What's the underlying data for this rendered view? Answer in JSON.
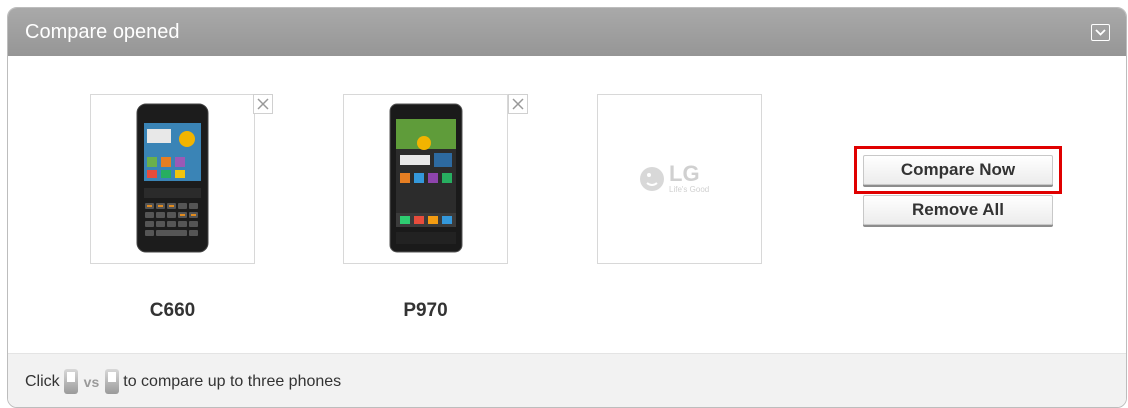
{
  "panel": {
    "title": "Compare opened",
    "collapse_icon": "chevron-down-icon"
  },
  "slots": [
    {
      "model": "C660",
      "remove_icon": "close-icon"
    },
    {
      "model": "P970",
      "remove_icon": "close-icon"
    },
    {
      "placeholder_logo": "LG",
      "placeholder_tagline": "Life's Good"
    }
  ],
  "actions": {
    "compare_now": "Compare Now",
    "remove_all": "Remove All"
  },
  "footer": {
    "prefix": "Click",
    "vs": "vs",
    "suffix": "to compare up to three phones"
  },
  "colors": {
    "header": "#a0a0a0",
    "highlight": "#e00000"
  }
}
